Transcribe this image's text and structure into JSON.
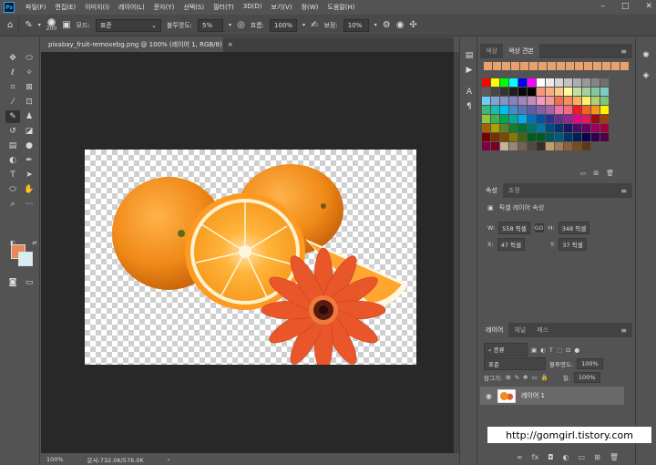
{
  "app": {
    "logo": "Ps",
    "menu": [
      "파일(F)",
      "편집(E)",
      "이미지(I)",
      "레이어(L)",
      "문자(Y)",
      "선택(S)",
      "필터(T)",
      "3D(D)",
      "보기(V)",
      "창(W)",
      "도움말(H)"
    ]
  },
  "options": {
    "brush_size": "200",
    "mode_label": "모드:",
    "mode_value": "표준",
    "opacity_label": "불투명도:",
    "opacity_value": "5%",
    "flow_label": "흐름:",
    "flow_value": "100%",
    "smooth_label": "보정:",
    "smooth_value": "10%"
  },
  "document": {
    "tab_title": "pixabay_fruit-removebg.png @ 100% (레이어 1, RGB/8)",
    "close": "×",
    "zoom": "100%",
    "doc_size": "문서:732.0K/576.0K"
  },
  "swatches_panel": {
    "tabs": [
      "색상",
      "색상 견본"
    ],
    "active_tab": 1
  },
  "properties_panel": {
    "tabs": [
      "속성",
      "조정"
    ],
    "active_tab": 0,
    "title": "픽셀 레이어 속성",
    "w_label": "W:",
    "w_value": "558 픽셀",
    "h_label": "H:",
    "h_value": "348 픽셀",
    "x_label": "X:",
    "x_value": "47 픽셀",
    "y_label": "Y:",
    "y_value": "37 픽셀",
    "link": "GO"
  },
  "layers_panel": {
    "tabs": [
      "레이어",
      "채널",
      "패스"
    ],
    "active_tab": 0,
    "filter_kind": "종류",
    "blend_mode": "표준",
    "opacity_label": "불투명도:",
    "opacity_value": "100%",
    "lock_label": "잠그기:",
    "fill_label": "칠:",
    "fill_value": "100%",
    "layer_name": "레이어 1"
  },
  "watermark": "http://gomgirl.tistory.com",
  "colors": {
    "foreground": "#e8875a",
    "background": "#d6eef0",
    "orange": "#f28b1e"
  }
}
